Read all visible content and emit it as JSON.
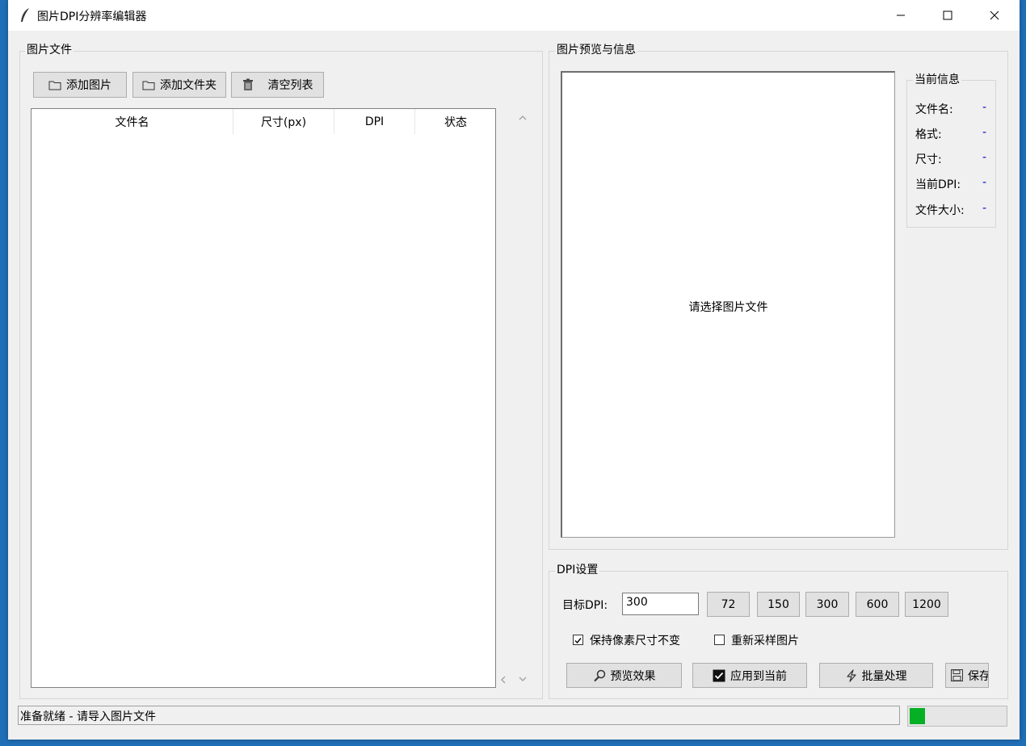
{
  "window": {
    "title": "图片DPI分辨率编辑器"
  },
  "left": {
    "group_title": "图片文件",
    "add_image": "添加图片",
    "add_folder": "添加文件夹",
    "clear_list": "清空列表",
    "columns": [
      "文件名",
      "尺寸(px)",
      "DPI",
      "状态"
    ],
    "rows": []
  },
  "right": {
    "group_title": "图片预览与信息",
    "preview_placeholder": "请选择图片文件",
    "info_title": "当前信息",
    "info": [
      {
        "label": "文件名:",
        "value": "-"
      },
      {
        "label": "格式:",
        "value": "-"
      },
      {
        "label": "尺寸:",
        "value": "-"
      },
      {
        "label": "当前DPI:",
        "value": "-"
      },
      {
        "label": "文件大小:",
        "value": "-"
      }
    ]
  },
  "dpi": {
    "group_title": "DPI设置",
    "target_label": "目标DPI:",
    "target_value": "300",
    "presets": [
      "72",
      "150",
      "300",
      "600",
      "1200"
    ],
    "keep_pixels_label": "保持像素尺寸不变",
    "keep_pixels_checked": true,
    "resample_label": "重新采样图片",
    "resample_checked": false,
    "preview_btn": "预览效果",
    "apply_btn": "应用到当前",
    "batch_btn": "批量处理",
    "save_btn": "保存"
  },
  "status": {
    "text": "准备就绪 - 请导入图片文件",
    "progress": 0.16,
    "progress_color": "#06b025"
  },
  "colors": {
    "info_value": "#0000cc",
    "window_bg": "#f0f0f0",
    "desktop": "#1f6fb8"
  }
}
